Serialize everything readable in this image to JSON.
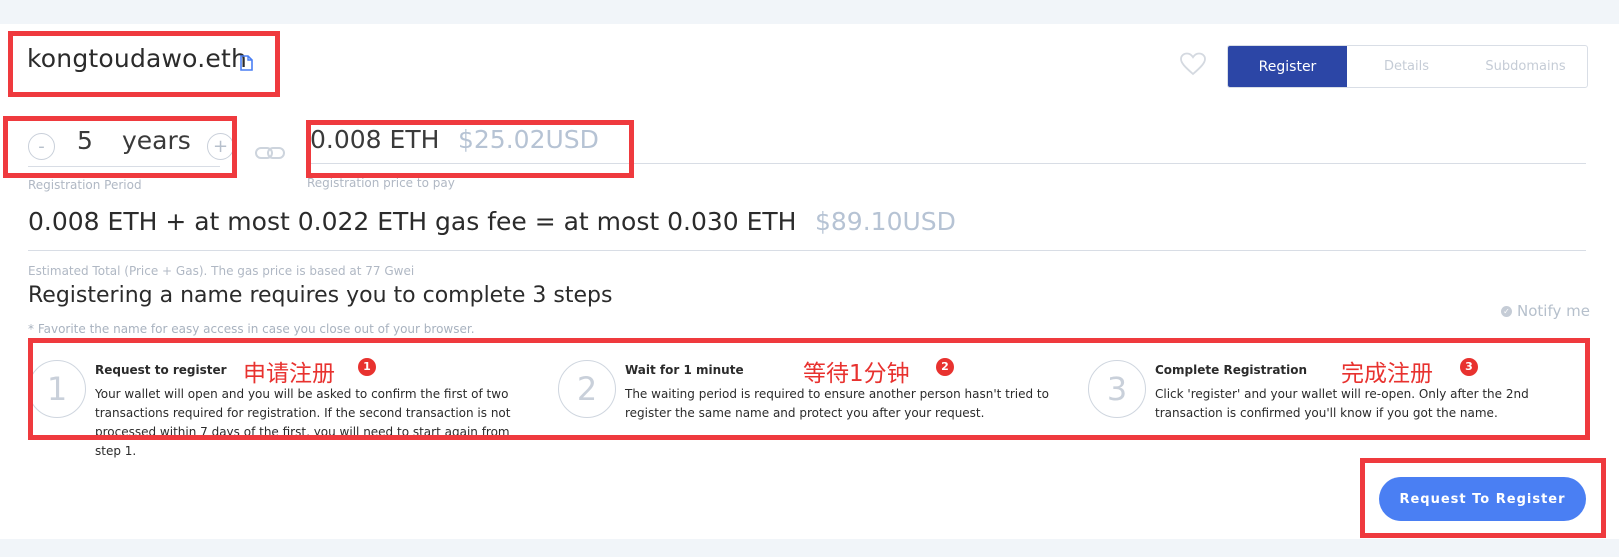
{
  "header": {
    "domain_name": "kongtoudawo.eth",
    "tabs": [
      {
        "label": "Register",
        "active": true
      },
      {
        "label": "Details",
        "active": false
      },
      {
        "label": "Subdomains",
        "active": false
      }
    ]
  },
  "period": {
    "minus_label": "-",
    "plus_label": "+",
    "value": "5",
    "unit": "years",
    "caption": "Registration Period"
  },
  "price": {
    "eth": "0.008 ETH",
    "usd": "$25.02USD",
    "caption": "Registration price to pay"
  },
  "total": {
    "line": "0.008 ETH + at most 0.022 ETH gas fee = at most 0.030 ETH",
    "usd": "$89.10USD",
    "caption": "Estimated Total (Price + Gas). The gas price is based at 77 Gwei"
  },
  "steps_section": {
    "heading": "Registering a name requires you to complete 3 steps",
    "note": "* Favorite the name for easy access in case you close out of your browser.",
    "notify_label": "Notify me"
  },
  "steps": [
    {
      "number": "1",
      "title": "Request to register",
      "description": "Your wallet will open and you will be asked to confirm the first of two transactions required for registration. If the second transaction is not processed within 7 days of the first, you will need to start again from step 1.",
      "annotation": "申请注册",
      "badge": "1"
    },
    {
      "number": "2",
      "title": "Wait for 1 minute",
      "description": "The waiting period is required to ensure another person hasn't tried to register the same name and protect you after your request.",
      "annotation": "等待1分钟",
      "badge": "2"
    },
    {
      "number": "3",
      "title": "Complete Registration",
      "description": "Click 'register' and your wallet will re-open. Only after the 2nd transaction is confirmed you'll know if you got the name.",
      "annotation": "完成注册",
      "badge": "3"
    }
  ],
  "cta": {
    "label": "Request To Register"
  },
  "colors": {
    "primary": "#2c46a6",
    "button": "#4a7ff3",
    "annotation": "#e8322f",
    "muted": "#b6c3d4"
  },
  "icons": [
    "document-icon",
    "heart-icon",
    "link-icon",
    "check-circle-icon"
  ]
}
